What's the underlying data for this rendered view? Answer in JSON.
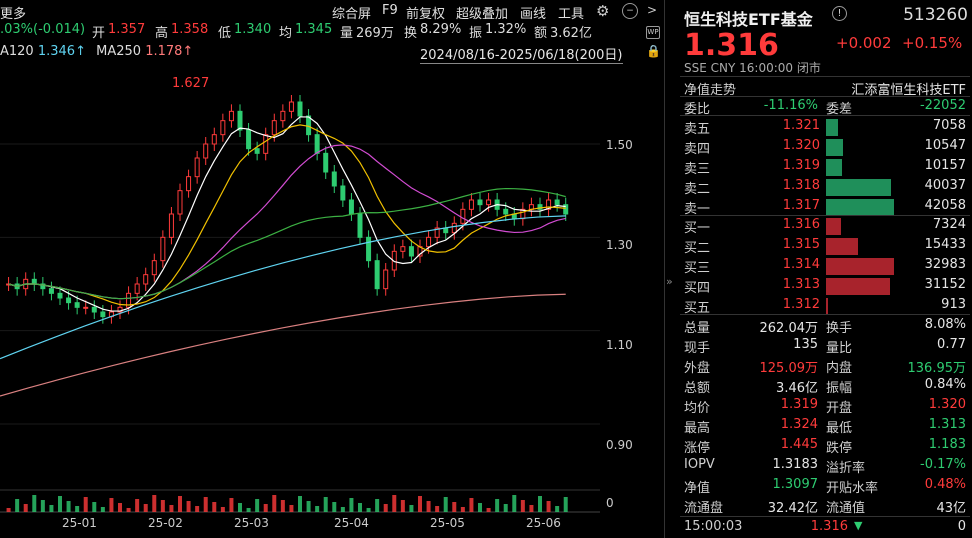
{
  "toolbar": {
    "more": "更多",
    "change": ".03%(-0.014)",
    "open_label": "开",
    "open_value": "1.357",
    "high_label": "高",
    "high_value": "1.358",
    "low_label": "低",
    "low_value": "1.340",
    "avg_label": "均",
    "avg_value": "1.345",
    "vol_label": "量",
    "vol_value": "269万",
    "turnover_label": "换",
    "turnover_value": "8.29%",
    "amp_label": "振",
    "amp_value": "1.32%",
    "amount_label": "额",
    "amount_value": "3.62亿",
    "menu": [
      "综合屏",
      "F9",
      "前复权",
      "超级叠加",
      "画线",
      "工具"
    ],
    "wp_icon": "WP"
  },
  "ma_bar": {
    "ma120_label": "A120",
    "ma120_value": "1.346↑",
    "ma250_label": "MA250",
    "ma250_value": "1.178↑",
    "date_range": "2024/08/16-2025/06/18(200日)"
  },
  "chart_data": {
    "type": "candlestick",
    "high_marker": "1.627",
    "y_ticks": [
      "1.50",
      "1.30",
      "1.10",
      "0.90"
    ],
    "y_tick_values": [
      1.5,
      1.3,
      1.1,
      0.9
    ],
    "x_ticks": [
      "25-01",
      "25-02",
      "25-03",
      "25-04",
      "25-05",
      "25-06"
    ],
    "volume_tick": "0",
    "ylim": [
      0.78,
      1.68
    ],
    "closes": [
      1.2,
      1.19,
      1.21,
      1.2,
      1.19,
      1.18,
      1.17,
      1.16,
      1.15,
      1.15,
      1.14,
      1.13,
      1.14,
      1.15,
      1.18,
      1.2,
      1.22,
      1.25,
      1.3,
      1.35,
      1.4,
      1.43,
      1.47,
      1.5,
      1.52,
      1.55,
      1.57,
      1.53,
      1.49,
      1.48,
      1.52,
      1.55,
      1.57,
      1.59,
      1.56,
      1.52,
      1.48,
      1.44,
      1.41,
      1.38,
      1.35,
      1.3,
      1.25,
      1.19,
      1.23,
      1.27,
      1.28,
      1.26,
      1.28,
      1.3,
      1.32,
      1.31,
      1.33,
      1.36,
      1.38,
      1.37,
      1.38,
      1.36,
      1.35,
      1.34,
      1.36,
      1.37,
      1.36,
      1.38,
      1.37,
      1.35
    ],
    "ma_values": [
      1.346,
      1.178
    ]
  },
  "panel": {
    "title": "恒生科技ETF基金",
    "code": "513260",
    "price": "1.316",
    "change": "+0.002",
    "change_pct": "+0.15%",
    "meta": "SSE  CNY  16:00:00  闭市",
    "trend_label": "净值走势",
    "fund_name": "汇添富恒生科技ETF",
    "weibi_label": "委比",
    "weibi_value": "-11.16%",
    "weicha_label": "委差",
    "weicha_value": "-22052",
    "asks": [
      {
        "label": "卖五",
        "price": "1.321",
        "vol": "7058",
        "ratio": 0.17
      },
      {
        "label": "卖四",
        "price": "1.320",
        "vol": "10547",
        "ratio": 0.25
      },
      {
        "label": "卖三",
        "price": "1.319",
        "vol": "10157",
        "ratio": 0.24
      },
      {
        "label": "卖二",
        "price": "1.318",
        "vol": "40037",
        "ratio": 0.95
      },
      {
        "label": "卖一",
        "price": "1.317",
        "vol": "42058",
        "ratio": 1.0
      }
    ],
    "bids": [
      {
        "label": "买一",
        "price": "1.316",
        "vol": "7324",
        "ratio": 0.22
      },
      {
        "label": "买二",
        "price": "1.315",
        "vol": "15433",
        "ratio": 0.47
      },
      {
        "label": "买三",
        "price": "1.314",
        "vol": "32983",
        "ratio": 1.0
      },
      {
        "label": "买四",
        "price": "1.313",
        "vol": "31152",
        "ratio": 0.94
      },
      {
        "label": "买五",
        "price": "1.312",
        "vol": "913",
        "ratio": 0.03
      }
    ],
    "stats": [
      {
        "l1": "总量",
        "v1": "262.04万",
        "c1": "white",
        "l2": "换手",
        "v2": "8.08%",
        "c2": "white"
      },
      {
        "l1": "现手",
        "v1": "135",
        "c1": "white",
        "l2": "量比",
        "v2": "0.77",
        "c2": "white"
      },
      {
        "l1": "外盘",
        "v1": "125.09万",
        "c1": "up",
        "l2": "内盘",
        "v2": "136.95万",
        "c2": "down"
      },
      {
        "l1": "总额",
        "v1": "3.46亿",
        "c1": "white",
        "l2": "振幅",
        "v2": "0.84%",
        "c2": "white"
      },
      {
        "l1": "均价",
        "v1": "1.319",
        "c1": "up",
        "l2": "开盘",
        "v2": "1.320",
        "c2": "up"
      },
      {
        "l1": "最高",
        "v1": "1.324",
        "c1": "up",
        "l2": "最低",
        "v2": "1.313",
        "c2": "down"
      },
      {
        "l1": "涨停",
        "v1": "1.445",
        "c1": "up",
        "l2": "跌停",
        "v2": "1.183",
        "c2": "down"
      },
      {
        "l1": "IOPV",
        "v1": "1.3183",
        "c1": "white",
        "l2": "溢折率",
        "v2": "-0.17%",
        "c2": "down"
      },
      {
        "l1": "净值",
        "v1": "1.3097",
        "c1": "down",
        "l2": "开贴水率",
        "v2": "0.48%",
        "c2": "up"
      },
      {
        "l1": "流通盘",
        "v1": "32.42亿",
        "c1": "white",
        "l2": "流通值",
        "v2": "43亿",
        "c2": "white"
      }
    ],
    "tick": {
      "time": "15:00:03",
      "price": "1.316",
      "arrow": "🡇",
      "vol": "0"
    }
  },
  "colors": {
    "up": "#ff3b3b",
    "down": "#2ecc71",
    "bg": "#000000"
  }
}
